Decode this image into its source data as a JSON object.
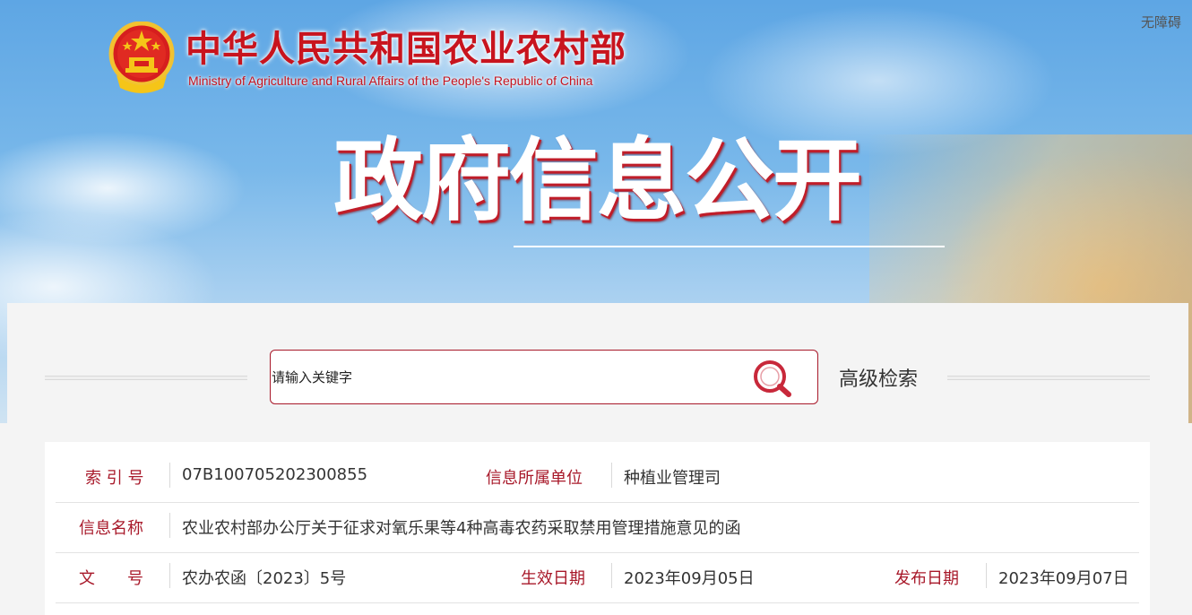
{
  "header": {
    "site_title_cn": "中华人民共和国农业农村部",
    "site_title_en": "Ministry of Agriculture and Rural Affairs of the People's Republic of China",
    "accessibility_label": "无障碍",
    "banner_heading": "政府信息公开"
  },
  "search": {
    "placeholder": "请输入关键字",
    "advanced_label": "高级检索"
  },
  "info": {
    "index_label": "索 引 号",
    "index_value": "07B100705202300855",
    "unit_label": "信息所属单位",
    "unit_value": "种植业管理司",
    "name_label": "信息名称",
    "name_value": "农业农村部办公厅关于征求对氧乐果等4种高毒农药采取禁用管理措施意见的函",
    "doc_label": "文　　号",
    "doc_value": "农办农函〔2023〕5号",
    "effective_label": "生效日期",
    "effective_value": "2023年09月05日",
    "published_label": "发布日期",
    "published_value": "2023年09月07日"
  },
  "colors": {
    "brand_red": "#c8141e",
    "label_red": "#a8192a"
  },
  "icons": {
    "emblem": "national-emblem-icon",
    "search": "search-icon"
  }
}
